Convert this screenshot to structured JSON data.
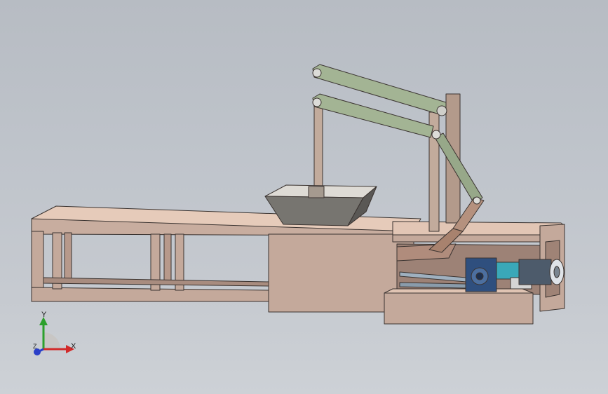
{
  "viewport": {
    "background_top": "#b7bcc3",
    "background_bottom": "#cdd1d6"
  },
  "model": {
    "frame_color": "#c4a99b",
    "frame_top_color": "#e6cbba",
    "frame_dark_color": "#8e7468",
    "linkage_color": "#a3b494",
    "linkage_dark_color": "#5d6e52",
    "post_color": "#c2ab9c",
    "hopper_color": "#777570",
    "hopper_inner_color": "#dedbd5",
    "motor_color": "#5d7fa6",
    "gearbox_color": "#2f4f7e",
    "belt_color": "#9fb0bf"
  },
  "triad": {
    "labels": {
      "x": "X",
      "y": "Y",
      "z": "Z"
    },
    "colors": {
      "x": "#d22a2a",
      "y": "#2ca02c",
      "z": "#2a3fc8"
    }
  }
}
